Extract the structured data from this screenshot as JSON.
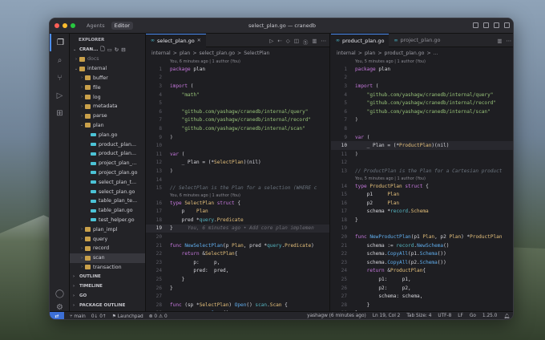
{
  "window": {
    "title": "select_plan.go — cranedb",
    "tabs": [
      "Agents",
      "Editor"
    ]
  },
  "sidebar": {
    "header": "EXPLORER",
    "repo": "CRAN...",
    "items": [
      {
        "label": "docs",
        "indent": 1,
        "type": "folder",
        "dim": true
      },
      {
        "label": "internal",
        "indent": 1,
        "type": "folder",
        "open": true
      },
      {
        "label": "buffer",
        "indent": 2,
        "type": "folder"
      },
      {
        "label": "file",
        "indent": 2,
        "type": "folder"
      },
      {
        "label": "log",
        "indent": 2,
        "type": "folder"
      },
      {
        "label": "metadata",
        "indent": 2,
        "type": "folder"
      },
      {
        "label": "parse",
        "indent": 2,
        "type": "folder"
      },
      {
        "label": "plan",
        "indent": 2,
        "type": "folder",
        "open": true
      },
      {
        "label": "plan.go",
        "indent": 3,
        "type": "go"
      },
      {
        "label": "product_plan...",
        "indent": 3,
        "type": "go"
      },
      {
        "label": "product_plan...",
        "indent": 3,
        "type": "go"
      },
      {
        "label": "project_plan_...",
        "indent": 3,
        "type": "go"
      },
      {
        "label": "project_plan.go",
        "indent": 3,
        "type": "go"
      },
      {
        "label": "select_plan_t...",
        "indent": 3,
        "type": "go"
      },
      {
        "label": "select_plan.go",
        "indent": 3,
        "type": "go"
      },
      {
        "label": "table_plan_te...",
        "indent": 3,
        "type": "go"
      },
      {
        "label": "table_plan.go",
        "indent": 3,
        "type": "go"
      },
      {
        "label": "test_helper.go",
        "indent": 3,
        "type": "go"
      },
      {
        "label": "plan_impl",
        "indent": 2,
        "type": "folder"
      },
      {
        "label": "query",
        "indent": 2,
        "type": "folder"
      },
      {
        "label": "record",
        "indent": 2,
        "type": "folder"
      },
      {
        "label": "scan",
        "indent": 2,
        "type": "folder",
        "hl": true
      },
      {
        "label": "transaction",
        "indent": 2,
        "type": "folder"
      }
    ],
    "sections": [
      "OUTLINE",
      "TIMELINE",
      "GO",
      "PACKAGE OUTLINE"
    ]
  },
  "left": {
    "tab": "select_plan.go",
    "breadcrumb": [
      "internal",
      ">",
      "plan",
      ">",
      "select_plan.go",
      ">",
      "SelectPlan"
    ],
    "blame": "You, 6 minutes ago | 1 author (You)",
    "lines": [
      {
        "n": "1",
        "h": [
          [
            "kw",
            "package "
          ],
          [
            "txt",
            "plan"
          ]
        ]
      },
      {
        "n": "2",
        "h": []
      },
      {
        "n": "3",
        "h": [
          [
            "kw",
            "import "
          ],
          [
            "txt",
            "("
          ]
        ]
      },
      {
        "n": "4",
        "h": [
          [
            "str",
            "    \"math\""
          ]
        ]
      },
      {
        "n": "5",
        "h": []
      },
      {
        "n": "6",
        "h": [
          [
            "str",
            "    \"github.com/yashagw/cranedb/internal/query\""
          ]
        ]
      },
      {
        "n": "7",
        "h": [
          [
            "str",
            "    \"github.com/yashagw/cranedb/internal/record\""
          ]
        ]
      },
      {
        "n": "8",
        "h": [
          [
            "str",
            "    \"github.com/yashagw/cranedb/internal/scan\""
          ]
        ]
      },
      {
        "n": "9",
        "h": [
          [
            "txt",
            ")"
          ]
        ]
      },
      {
        "n": "10",
        "h": []
      },
      {
        "n": "11",
        "h": [
          [
            "kw",
            "var "
          ],
          [
            "txt",
            "("
          ]
        ]
      },
      {
        "n": "12",
        "h": [
          [
            "txt",
            "    _ Plan = (*"
          ],
          [
            "typ",
            "SelectPlan"
          ],
          [
            "txt",
            ")(nil)"
          ]
        ]
      },
      {
        "n": "13",
        "h": [
          [
            "txt",
            ")"
          ]
        ]
      },
      {
        "n": "14",
        "h": []
      },
      {
        "n": "15",
        "h": [
          [
            "cm",
            "// SelectPlan is the Plan for a selection (WHERE c"
          ]
        ]
      },
      {
        "lens": "You, 6 minutes ago | 1 author (You)"
      },
      {
        "n": "16",
        "h": [
          [
            "kw",
            "type "
          ],
          [
            "typ",
            "SelectPlan "
          ],
          [
            "kw",
            "struct "
          ],
          [
            "txt",
            "{"
          ]
        ]
      },
      {
        "n": "17",
        "h": [
          [
            "txt",
            "    p    "
          ],
          [
            "typ",
            "Plan"
          ]
        ]
      },
      {
        "n": "18",
        "h": [
          [
            "txt",
            "    pred *"
          ],
          [
            "pkg",
            "query"
          ],
          [
            "txt",
            "."
          ],
          [
            "typ",
            "Predicate"
          ]
        ]
      },
      {
        "n": "19",
        "cur": true,
        "h": [
          [
            "txt",
            "}"
          ],
          [
            "ghost",
            "     You, 6 minutes ago • Add core plan implemen"
          ]
        ]
      },
      {
        "n": "20",
        "h": []
      },
      {
        "n": "21",
        "h": [
          [
            "kw",
            "func "
          ],
          [
            "fn",
            "NewSelectPlan"
          ],
          [
            "txt",
            "(p "
          ],
          [
            "typ",
            "Plan"
          ],
          [
            "txt",
            ", pred *"
          ],
          [
            "pkg",
            "query"
          ],
          [
            "txt",
            "."
          ],
          [
            "typ",
            "Predicate"
          ],
          [
            "txt",
            ")"
          ]
        ]
      },
      {
        "n": "22",
        "h": [
          [
            "kw",
            "    return "
          ],
          [
            "txt",
            "&"
          ],
          [
            "typ",
            "SelectPlan"
          ],
          [
            "txt",
            "{"
          ]
        ]
      },
      {
        "n": "23",
        "h": [
          [
            "txt",
            "        p:     p,"
          ]
        ]
      },
      {
        "n": "24",
        "h": [
          [
            "txt",
            "        pred:  pred,"
          ]
        ]
      },
      {
        "n": "25",
        "h": [
          [
            "txt",
            "    }"
          ]
        ]
      },
      {
        "n": "26",
        "h": [
          [
            "txt",
            "}"
          ]
        ]
      },
      {
        "n": "27",
        "h": []
      },
      {
        "n": "28",
        "h": [
          [
            "kw",
            "func "
          ],
          [
            "txt",
            "(sp *"
          ],
          [
            "typ",
            "SelectPlan"
          ],
          [
            "txt",
            ") "
          ],
          [
            "fn",
            "Open"
          ],
          [
            "txt",
            "() "
          ],
          [
            "pkg",
            "scan"
          ],
          [
            "txt",
            "."
          ],
          [
            "typ",
            "Scan"
          ],
          [
            "txt",
            " {"
          ]
        ]
      },
      {
        "n": "29",
        "h": [
          [
            "txt",
            "    s := sp.p."
          ],
          [
            "fn",
            "Open"
          ],
          [
            "txt",
            "()"
          ]
        ]
      },
      {
        "n": "30",
        "h": [
          [
            "kw",
            "    return "
          ],
          [
            "pkg",
            "query"
          ],
          [
            "txt",
            "."
          ],
          [
            "fn",
            "NewSelectScan"
          ],
          [
            "txt",
            "(s, sp.pred)"
          ]
        ]
      }
    ]
  },
  "right": {
    "tabs": [
      "product_plan.go",
      "project_plan.go"
    ],
    "breadcrumb": [
      "internal",
      ">",
      "plan",
      ">",
      "product_plan.go",
      ">",
      "..."
    ],
    "blame": "You, 5 minutes ago | 1 author (You)",
    "lines": [
      {
        "n": "1",
        "h": [
          [
            "kw",
            "package "
          ],
          [
            "txt",
            "plan"
          ]
        ]
      },
      {
        "n": "2",
        "h": []
      },
      {
        "n": "3",
        "h": [
          [
            "kw",
            "import "
          ],
          [
            "txt",
            "("
          ]
        ]
      },
      {
        "n": "4",
        "h": [
          [
            "str",
            "    \"github.com/yashagw/cranedb/internal/query\""
          ]
        ]
      },
      {
        "n": "5",
        "h": [
          [
            "str",
            "    \"github.com/yashagw/cranedb/internal/record\""
          ]
        ]
      },
      {
        "n": "6",
        "h": [
          [
            "str",
            "    \"github.com/yashagw/cranedb/internal/scan\""
          ]
        ]
      },
      {
        "n": "7",
        "h": [
          [
            "txt",
            ")"
          ]
        ]
      },
      {
        "n": "8",
        "h": []
      },
      {
        "n": "9",
        "h": [
          [
            "kw",
            "var "
          ],
          [
            "txt",
            "("
          ]
        ]
      },
      {
        "n": "10",
        "cur": true,
        "h": [
          [
            "txt",
            "    _ Plan = (*"
          ],
          [
            "typ",
            "ProductPlan"
          ],
          [
            "txt",
            ")(nil)"
          ]
        ]
      },
      {
        "n": "11",
        "h": [
          [
            "txt",
            ")"
          ]
        ]
      },
      {
        "n": "12",
        "h": []
      },
      {
        "n": "13",
        "h": [
          [
            "cm",
            "// ProductPlan is the Plan for a Cartesian product"
          ]
        ]
      },
      {
        "lens": "You, 5 minutes ago | 1 author (You)"
      },
      {
        "n": "14",
        "h": [
          [
            "kw",
            "type "
          ],
          [
            "typ",
            "ProductPlan "
          ],
          [
            "kw",
            "struct "
          ],
          [
            "txt",
            "{"
          ]
        ]
      },
      {
        "n": "15",
        "h": [
          [
            "txt",
            "    p1     "
          ],
          [
            "typ",
            "Plan"
          ]
        ]
      },
      {
        "n": "16",
        "h": [
          [
            "txt",
            "    p2     "
          ],
          [
            "typ",
            "Plan"
          ]
        ]
      },
      {
        "n": "17",
        "h": [
          [
            "txt",
            "    schema *"
          ],
          [
            "pkg",
            "record"
          ],
          [
            "txt",
            "."
          ],
          [
            "typ",
            "Schema"
          ]
        ]
      },
      {
        "n": "18",
        "h": [
          [
            "txt",
            "}"
          ]
        ]
      },
      {
        "n": "19",
        "h": []
      },
      {
        "n": "20",
        "h": [
          [
            "kw",
            "func "
          ],
          [
            "fn",
            "NewProductPlan"
          ],
          [
            "txt",
            "(p1 "
          ],
          [
            "typ",
            "Plan"
          ],
          [
            "txt",
            ", p2 "
          ],
          [
            "typ",
            "Plan"
          ],
          [
            "txt",
            ") *"
          ],
          [
            "typ",
            "ProductPlan"
          ]
        ]
      },
      {
        "n": "21",
        "h": [
          [
            "txt",
            "    schema := "
          ],
          [
            "pkg",
            "record"
          ],
          [
            "txt",
            "."
          ],
          [
            "fn",
            "NewSchema"
          ],
          [
            "txt",
            "()"
          ]
        ]
      },
      {
        "n": "22",
        "h": [
          [
            "txt",
            "    schema."
          ],
          [
            "fn",
            "CopyAll"
          ],
          [
            "txt",
            "(p1."
          ],
          [
            "fn",
            "Schema"
          ],
          [
            "txt",
            "())"
          ]
        ]
      },
      {
        "n": "23",
        "h": [
          [
            "txt",
            "    schema."
          ],
          [
            "fn",
            "CopyAll"
          ],
          [
            "txt",
            "(p2."
          ],
          [
            "fn",
            "Schema"
          ],
          [
            "txt",
            "())"
          ]
        ]
      },
      {
        "n": "24",
        "h": [
          [
            "kw",
            "    return "
          ],
          [
            "txt",
            "&"
          ],
          [
            "typ",
            "ProductPlan"
          ],
          [
            "txt",
            "{"
          ]
        ]
      },
      {
        "n": "25",
        "h": [
          [
            "txt",
            "        p1:     p1,"
          ]
        ]
      },
      {
        "n": "26",
        "h": [
          [
            "txt",
            "        p2:     p2,"
          ]
        ]
      },
      {
        "n": "27",
        "h": [
          [
            "txt",
            "        schema: schema,"
          ]
        ]
      },
      {
        "n": "28",
        "h": [
          [
            "txt",
            "    }"
          ]
        ]
      },
      {
        "n": "29",
        "h": [
          [
            "txt",
            "}"
          ]
        ]
      },
      {
        "n": "30",
        "h": []
      },
      {
        "n": "31",
        "h": [
          [
            "kw",
            "func "
          ],
          [
            "txt",
            "(pp *"
          ],
          [
            "typ",
            "ProductPlan"
          ],
          [
            "txt",
            ") "
          ],
          [
            "fn",
            "Open"
          ],
          [
            "txt",
            "() "
          ],
          [
            "pkg",
            "scan"
          ],
          [
            "txt",
            "."
          ],
          [
            "typ",
            "Scan"
          ],
          [
            "txt",
            " {"
          ]
        ]
      }
    ]
  },
  "status": {
    "branch": "main",
    "sync": "0↓ 0↑",
    "launchpad": "Launchpad",
    "problems": "⊗ 0 ⚠ 0",
    "right": [
      "yashagw (6 minutes ago)",
      "Ln 19, Col 2",
      "Tab Size: 4",
      "UTF-8",
      "LF",
      "Go",
      "1.25.0"
    ]
  },
  "colors": {
    "accent": "#4d8ff8",
    "keyword": "#c678dd",
    "string": "#98c379",
    "type": "#e5c07b",
    "function": "#61afef"
  }
}
